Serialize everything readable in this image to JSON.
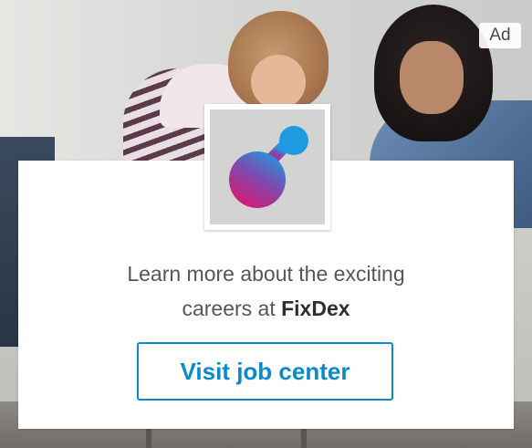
{
  "ad": {
    "badge": "Ad",
    "message_line1": "Learn more about the exciting",
    "message_line2_prefix": "careers at ",
    "brand": "FixDex",
    "cta_label": "Visit job center",
    "logo_icon": "fixdex-logo-icon",
    "background_image": "two-women-working-photo",
    "colors": {
      "cta": "#0a8acb",
      "logo_tile": "#d3d3d3",
      "logo_blob_top": "#1e9be0",
      "logo_blob_bottom": "#e0156e"
    }
  }
}
